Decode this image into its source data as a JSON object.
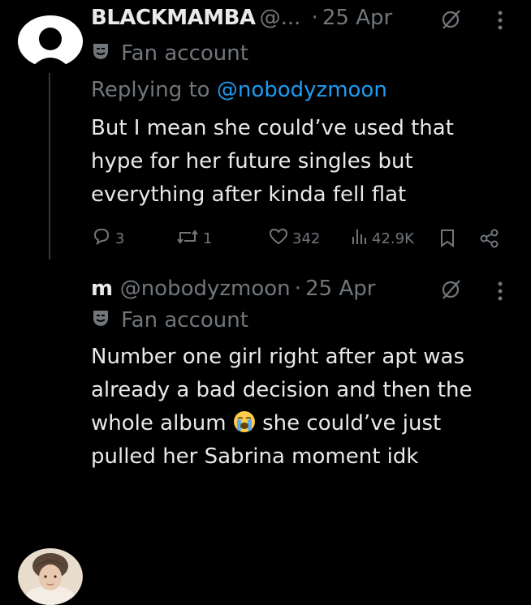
{
  "tweets": [
    {
      "display_name": "BLACKMAMBA",
      "handle": "@...",
      "dot": "·",
      "time": "25 Apr",
      "badge_label": "Fan account",
      "replying_prefix": "Replying to",
      "replying_to": "@nobodyzmoon",
      "body_lines": [
        "But I mean she could’ve used that",
        "hype for her future singles but",
        "everything after kinda fell flat"
      ],
      "actions": {
        "replies": "3",
        "reposts": "1",
        "likes": "342",
        "views": "42.9K"
      }
    },
    {
      "display_name": "m",
      "handle": "@nobodyzmoon",
      "dot": "·",
      "time": "25 Apr",
      "badge_label": "Fan account",
      "body_lines": [
        "Number one girl right after apt was",
        "already a bad decision and then the",
        "whole album",
        "she could’ve just",
        "pulled her Sabrina moment idk"
      ]
    }
  ],
  "colors": {
    "background": "#000000",
    "text": "#e7e9ea",
    "secondary": "#71767b",
    "link": "#1d9bf0"
  },
  "icons": {
    "not_interested": "slashed-circle-icon",
    "more": "more-vertical-icon",
    "badge": "theater-mask-icon",
    "reply": "reply-icon",
    "repost": "repost-icon",
    "like": "heart-icon",
    "views": "views-icon",
    "bookmark": "bookmark-icon",
    "share": "share-icon",
    "emoji": "loudly-crying-face-emoji"
  }
}
